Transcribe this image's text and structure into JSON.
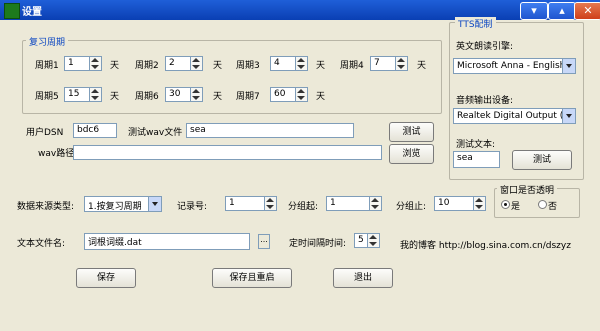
{
  "window": {
    "title": "设置",
    "min": "▾",
    "max": "▴",
    "close": "✕"
  },
  "review": {
    "group_title": "复习周期",
    "periods": [
      {
        "label": "周期1",
        "value": "1",
        "unit": "天"
      },
      {
        "label": "周期2",
        "value": "2",
        "unit": "天"
      },
      {
        "label": "周期3",
        "value": "4",
        "unit": "天"
      },
      {
        "label": "周期4",
        "value": "7",
        "unit": "天"
      },
      {
        "label": "周期5",
        "value": "15",
        "unit": "天"
      },
      {
        "label": "周期6",
        "value": "30",
        "unit": "天"
      },
      {
        "label": "周期7",
        "value": "60",
        "unit": "天"
      }
    ],
    "user_dsn_label": "用户DSN",
    "user_dsn_value": "bdc6",
    "test_wav_label": "测试wav文件",
    "test_wav_value": "sea",
    "test_button": "测试",
    "wav_path_label": "wav路径",
    "wav_path_value": "",
    "browse_button": "浏览"
  },
  "tts": {
    "group_title": "TTS配制",
    "engine_label": "英文朗读引擎:",
    "engine_value": "Microsoft Anna - English (United",
    "audio_label": "音频输出设备:",
    "audio_value": "Realtek Digital Output (Realtek",
    "test_text_label": "测试文本:",
    "test_text_value": "sea",
    "test_button": "测试"
  },
  "data_source": {
    "label": "数据来源类型:",
    "value": "1.按复习周期",
    "record_label": "记录号:",
    "record_value": "1",
    "split_start_label": "分组起:",
    "split_start_value": "1",
    "split_end_label": "分组止:",
    "split_end_value": "10"
  },
  "transparency": {
    "group_title": "窗口是否透明",
    "yes_label": "是",
    "no_label": "否",
    "selected": "yes"
  },
  "text_file": {
    "label": "文本文件名:",
    "value": "词根词缀.dat",
    "browse": "..."
  },
  "timer": {
    "label": "定时间隔时间:",
    "value": "5"
  },
  "blog": {
    "text": "我的博客 http://blog.sina.com.cn/dszyz"
  },
  "buttons": {
    "save": "保存",
    "save_restart": "保存且重启",
    "exit": "退出"
  }
}
